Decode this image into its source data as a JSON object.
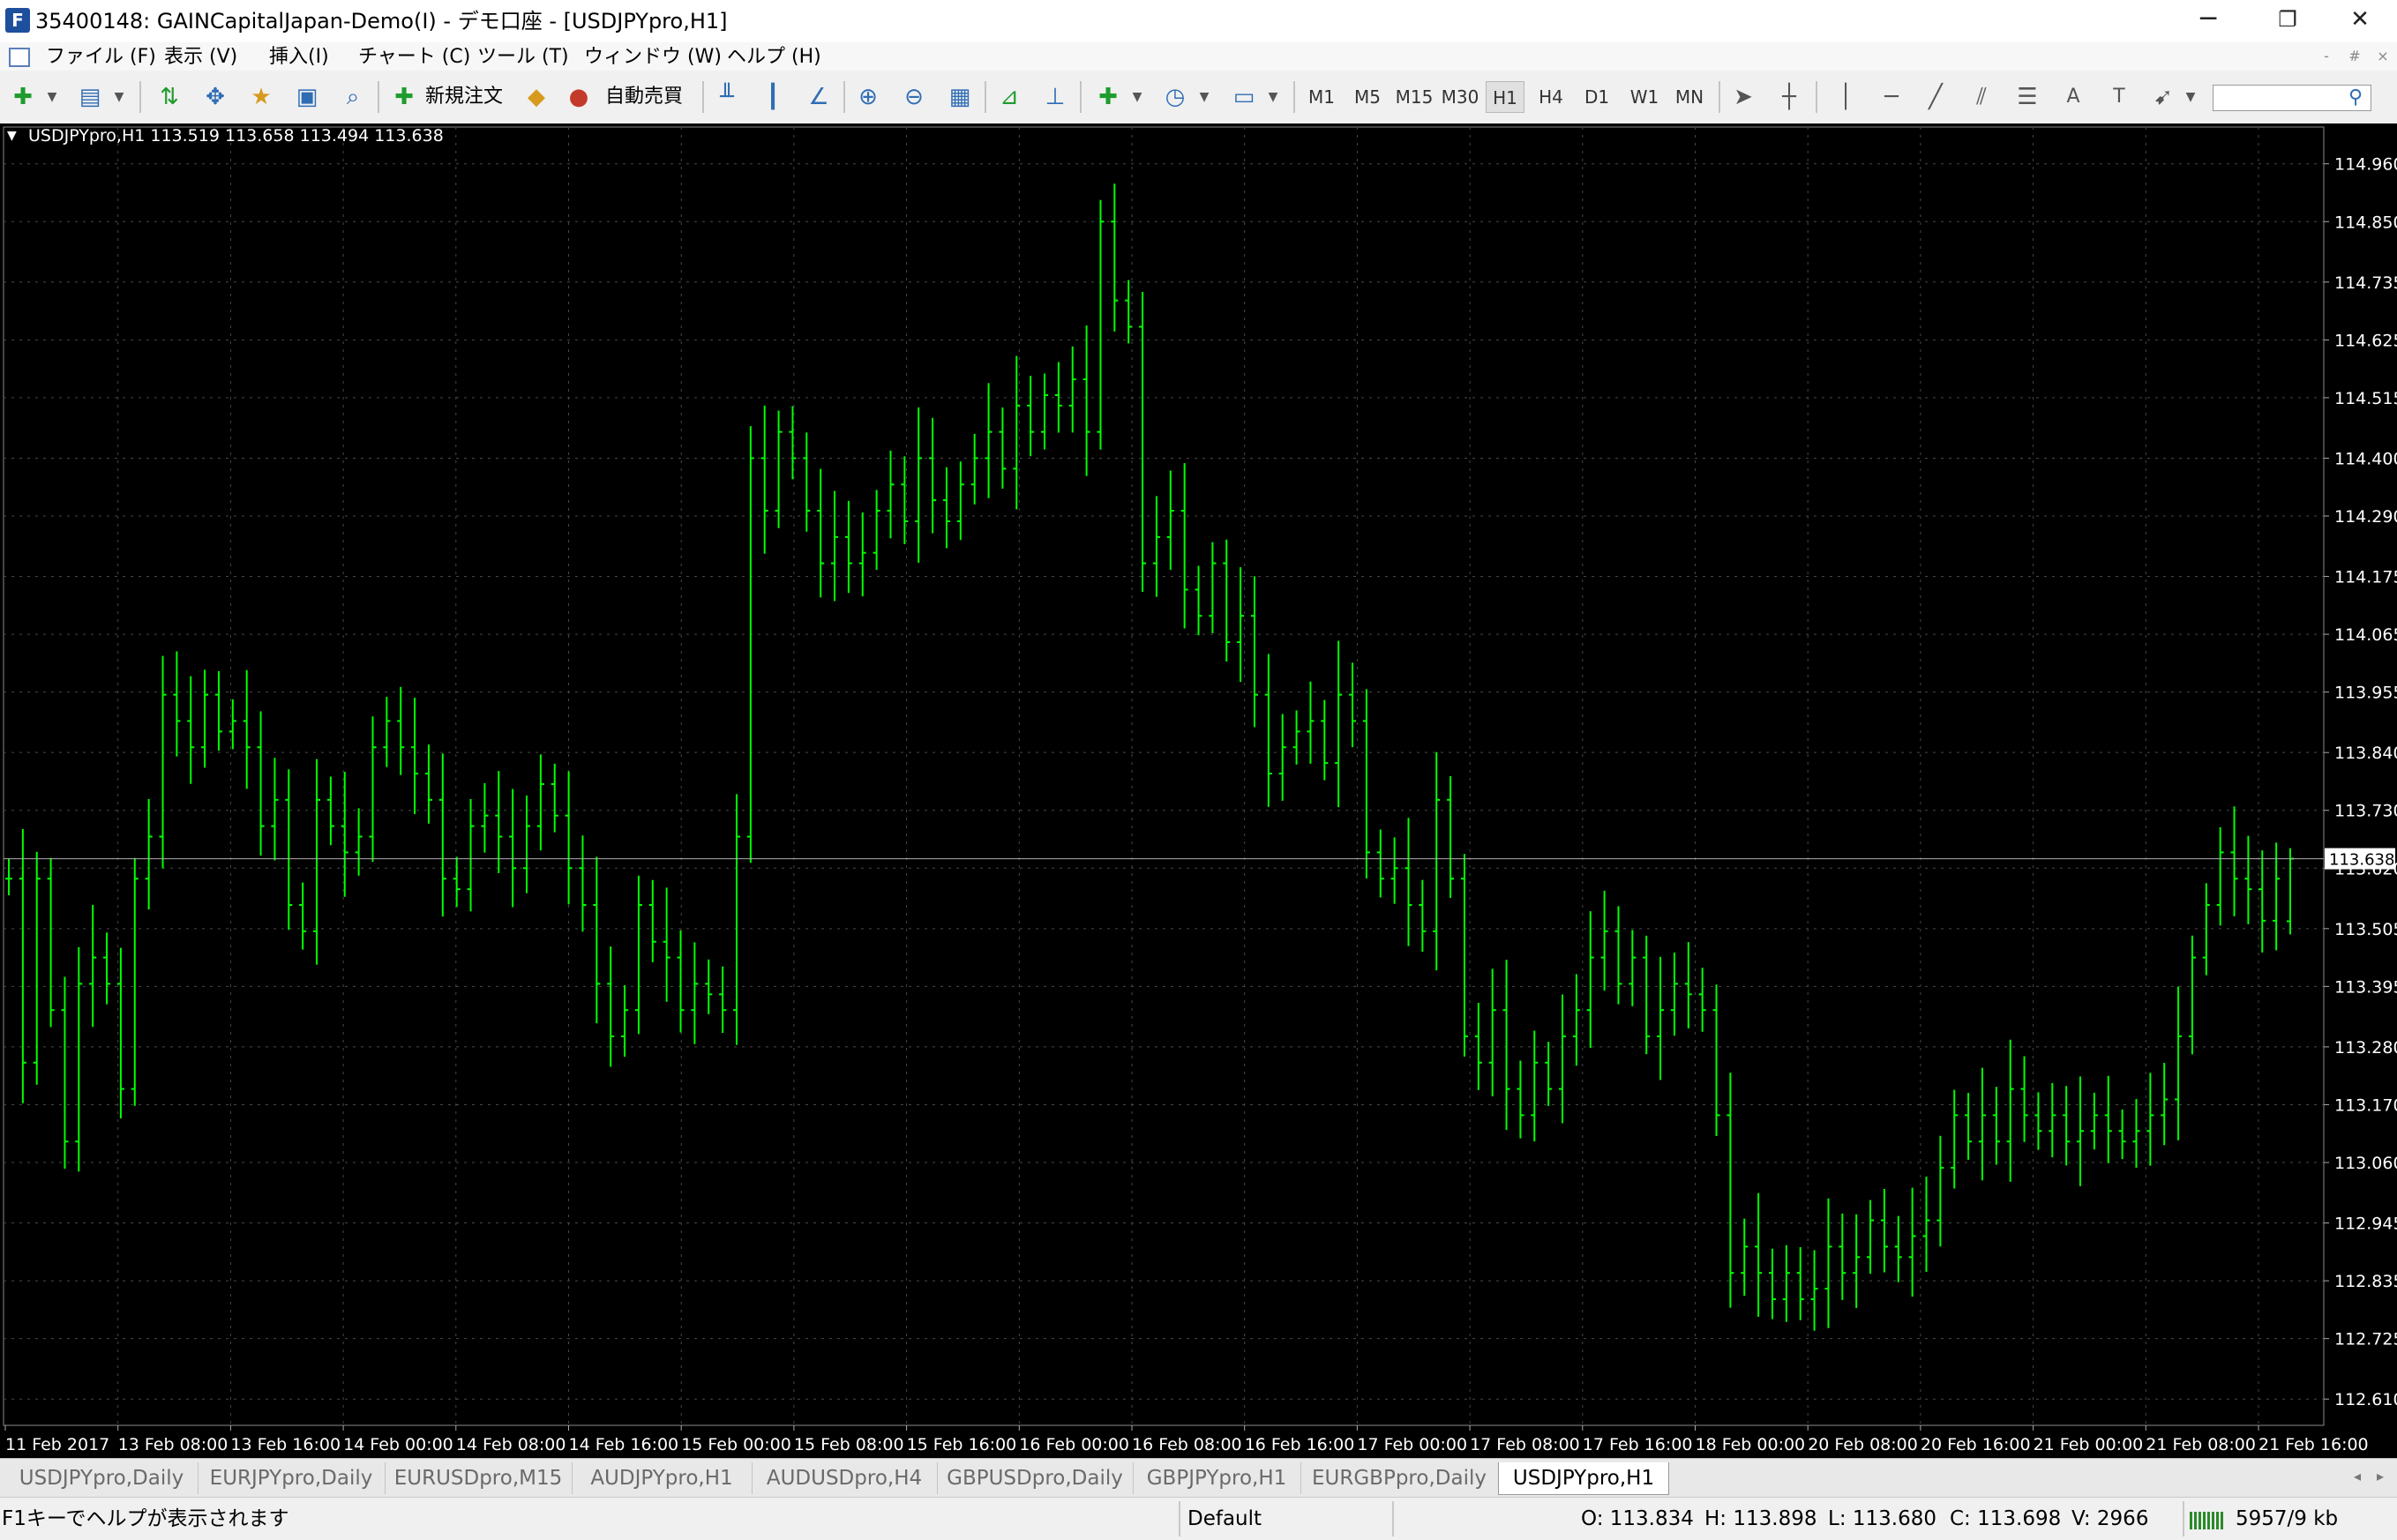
{
  "window": {
    "title": "35400148: GAINCapitalJapan-Demo(I) - デモ口座 - [USDJPYpro,H1]",
    "controls": {
      "minimize": "─",
      "restore": "❐",
      "close": "✕"
    }
  },
  "menu": {
    "items": [
      "ファイル (F)",
      "表示 (V)",
      "挿入(I)",
      "チャート (C)",
      "ツール (T)",
      "ウィンドウ (W)",
      "ヘルプ (H)"
    ],
    "mdi_controls": [
      "-",
      "#",
      "×"
    ]
  },
  "toolbar": {
    "new_order_label": "新規注文",
    "autotrading_label": "自動売買",
    "timeframes": [
      "M1",
      "M5",
      "M15",
      "M30",
      "H1",
      "H4",
      "D1",
      "W1",
      "MN"
    ],
    "active_timeframe": "H1",
    "search_placeholder": ""
  },
  "chart": {
    "info_line": "USDJPYpro,H1  113.519 113.658 113.494 113.638",
    "collapse_glyph": "▼",
    "current_price_label": "113.638",
    "price_axis": [
      "114.960",
      "114.850",
      "114.735",
      "114.625",
      "114.515",
      "114.400",
      "114.290",
      "114.175",
      "114.065",
      "113.955",
      "113.840",
      "113.730",
      "113.620",
      "113.505",
      "113.395",
      "113.280",
      "113.170",
      "113.060",
      "112.945",
      "112.835",
      "112.725",
      "112.610"
    ],
    "time_axis": [
      "11 Feb 2017",
      "13 Feb 08:00",
      "13 Feb 16:00",
      "14 Feb 00:00",
      "14 Feb 08:00",
      "14 Feb 16:00",
      "15 Feb 00:00",
      "15 Feb 08:00",
      "15 Feb 16:00",
      "16 Feb 00:00",
      "16 Feb 08:00",
      "16 Feb 16:00",
      "17 Feb 00:00",
      "17 Feb 08:00",
      "17 Feb 16:00",
      "18 Feb 00:00",
      "20 Feb 08:00",
      "20 Feb 16:00",
      "21 Feb 00:00",
      "21 Feb 08:00",
      "21 Feb 16:00"
    ],
    "colors": {
      "background": "#000000",
      "bars": "#00ff00",
      "grid": "#484848",
      "axis_text": "#ffffff"
    }
  },
  "tabs": {
    "items": [
      "USDJPYpro,Daily",
      "EURJPYpro,Daily",
      "EURUSDpro,M15",
      "AUDJPYpro,H1",
      "AUDUSDpro,H4",
      "GBPUSDpro,Daily",
      "GBPJPYpro,H1",
      "EURGBPpro,Daily",
      "USDJPYpro,H1"
    ],
    "active": "USDJPYpro,H1",
    "scroll_left": "◂",
    "scroll_right": "▸"
  },
  "status": {
    "help": "F1キーでヘルプが表示されます",
    "profile": "Default",
    "open": "O: 113.834",
    "high": "H: 113.898",
    "low": "L: 113.680",
    "close": "C: 113.698",
    "volume": "V: 2966",
    "traffic": "5957/9 kb"
  },
  "chart_data": {
    "type": "ohlc-bars",
    "symbol": "USDJPYpro",
    "timeframe": "H1",
    "last_bar": {
      "open": 113.519,
      "high": 113.658,
      "low": 113.494,
      "close": 113.638
    },
    "ylim": [
      112.56,
      115.03
    ],
    "current_price": 113.638,
    "closes": [
      113.6,
      113.25,
      113.6,
      113.35,
      113.1,
      113.4,
      113.45,
      113.4,
      113.2,
      113.6,
      113.68,
      113.95,
      113.9,
      113.85,
      113.95,
      113.88,
      113.9,
      113.85,
      113.7,
      113.75,
      113.55,
      113.5,
      113.75,
      113.7,
      113.65,
      113.68,
      113.85,
      113.9,
      113.85,
      113.8,
      113.75,
      113.6,
      113.58,
      113.7,
      113.72,
      113.68,
      113.62,
      113.7,
      113.78,
      113.72,
      113.62,
      113.55,
      113.4,
      113.3,
      113.35,
      113.55,
      113.48,
      113.45,
      113.35,
      113.4,
      113.38,
      113.35,
      113.68,
      114.4,
      114.3,
      114.45,
      114.4,
      114.3,
      114.2,
      114.25,
      114.2,
      114.22,
      114.3,
      114.35,
      114.28,
      114.4,
      114.32,
      114.28,
      114.35,
      114.4,
      114.45,
      114.38,
      114.5,
      114.45,
      114.52,
      114.5,
      114.55,
      114.45,
      114.85,
      114.7,
      114.65,
      114.2,
      114.25,
      114.3,
      114.15,
      114.1,
      114.2,
      114.05,
      114.1,
      113.95,
      113.8,
      113.85,
      113.88,
      113.9,
      113.82,
      113.95,
      113.9,
      113.65,
      113.6,
      113.62,
      113.55,
      113.5,
      113.75,
      113.6,
      113.3,
      113.25,
      113.35,
      113.2,
      113.15,
      113.25,
      113.2,
      113.3,
      113.35,
      113.45,
      113.5,
      113.4,
      113.45,
      113.3,
      113.35,
      113.4,
      113.38,
      113.35,
      113.15,
      112.85,
      112.9,
      112.85,
      112.8,
      112.85,
      112.8,
      112.82,
      112.9,
      112.85,
      112.88,
      112.95,
      112.9,
      112.88,
      112.92,
      112.95,
      113.05,
      113.15,
      113.1,
      113.15,
      113.1,
      113.2,
      113.15,
      113.12,
      113.15,
      113.1,
      113.12,
      113.15,
      113.12,
      113.1,
      113.12,
      113.15,
      113.18,
      113.3,
      113.45,
      113.55,
      113.65,
      113.6,
      113.58,
      113.52,
      113.6,
      113.638
    ]
  }
}
